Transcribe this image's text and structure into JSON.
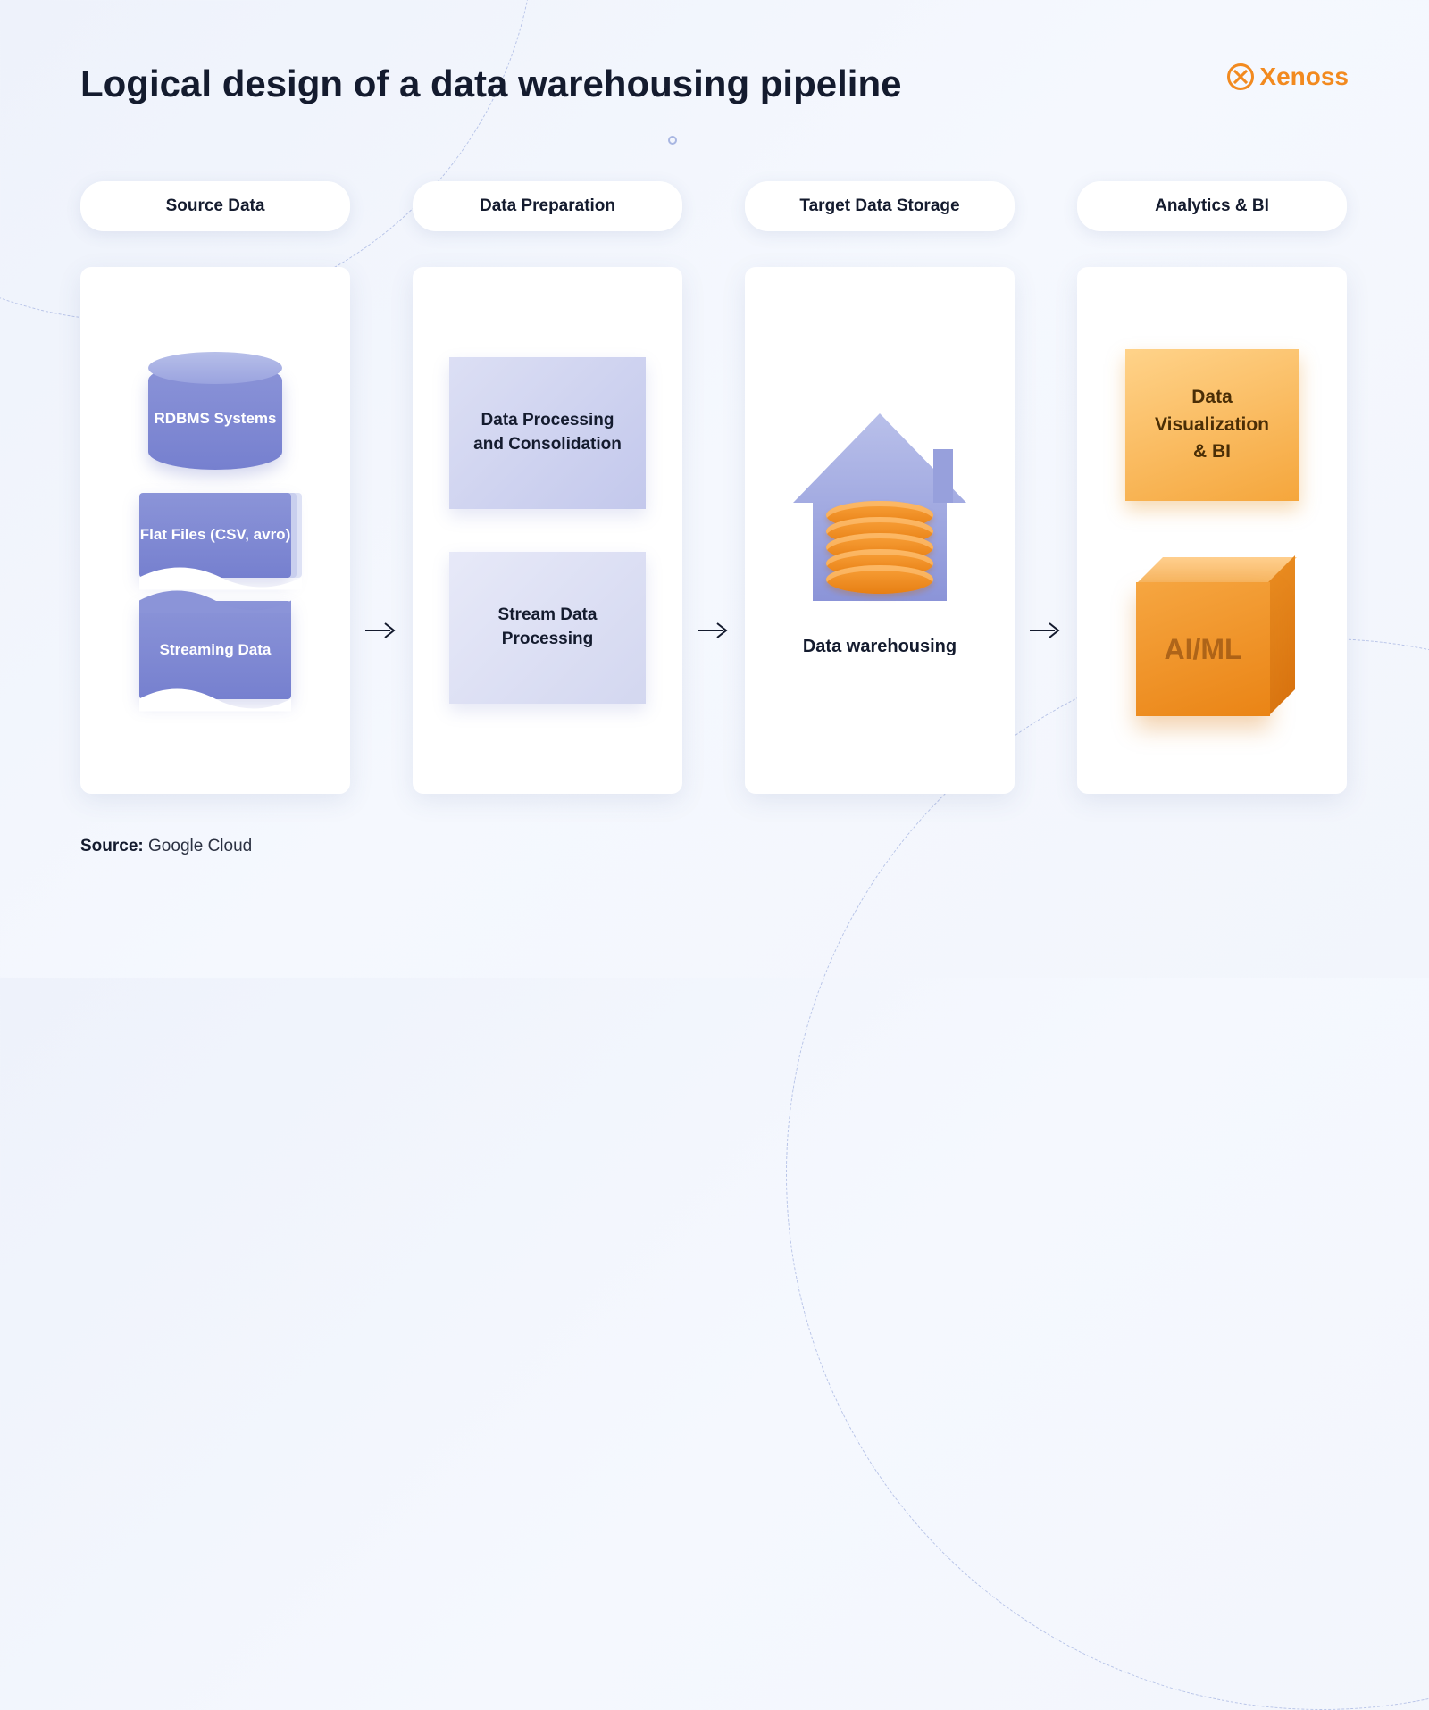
{
  "title": "Logical design of a data warehousing pipeline",
  "brand": "Xenoss",
  "stages": [
    {
      "header": "Source Data"
    },
    {
      "header": "Data Preparation"
    },
    {
      "header": "Target Data Storage"
    },
    {
      "header": "Analytics & BI"
    }
  ],
  "source_col": {
    "rdbms": "RDBMS Systems",
    "flat": "Flat Files (CSV, avro)",
    "stream": "Streaming Data"
  },
  "prep_col": {
    "batch": "Data Processing and Consolidation",
    "stream": "Stream Data Processing"
  },
  "target_col": {
    "label": "Data warehousing"
  },
  "bi_col": {
    "viz": "Data Visualization & BI",
    "cube": "AI/ML"
  },
  "source": {
    "label": "Source:",
    "value": " Google Cloud"
  },
  "colors": {
    "purple": "#7d88d4",
    "purple_light": "#c3c8ec",
    "orange": "#f28a1f",
    "orange_light": "#ffd38a",
    "text": "#141b2e"
  }
}
